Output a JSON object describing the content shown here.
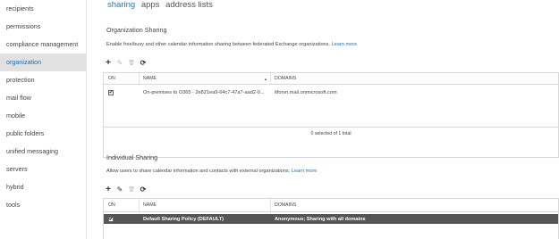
{
  "sidebar": {
    "items": [
      {
        "label": "recipients",
        "active": false
      },
      {
        "label": "permissions",
        "active": false
      },
      {
        "label": "compliance management",
        "active": false
      },
      {
        "label": "organization",
        "active": true
      },
      {
        "label": "protection",
        "active": false
      },
      {
        "label": "mail flow",
        "active": false
      },
      {
        "label": "mobile",
        "active": false
      },
      {
        "label": "public folders",
        "active": false
      },
      {
        "label": "unified messaging",
        "active": false
      },
      {
        "label": "servers",
        "active": false
      },
      {
        "label": "hybrid",
        "active": false
      },
      {
        "label": "tools",
        "active": false
      }
    ]
  },
  "tabs": [
    {
      "label": "sharing",
      "active": true
    },
    {
      "label": "apps",
      "active": false
    },
    {
      "label": "address lists",
      "active": false
    }
  ],
  "org_sharing": {
    "title": "Organization Sharing",
    "description": "Enable free/busy and other calendar information sharing between federated Exchange organizations.",
    "learn_more": "Learn more",
    "columns": {
      "on": "ON",
      "name": "NAME",
      "domains": "DOMAINS"
    },
    "rows": [
      {
        "on": true,
        "name": "On-premises to O365 - 2e821ea9-64c7-47a7-aad2-0...",
        "domains": "itforvn.mail.onmicrosoft.com"
      }
    ],
    "status": "0 selected of 1 total"
  },
  "individual_sharing": {
    "title": "Individual Sharing",
    "description": "Allow users to share calendar information and contacts with external organizations.",
    "learn_more": "Learn more",
    "columns": {
      "on": "ON",
      "name": "NAME",
      "domains": "DOMAINS"
    },
    "rows": [
      {
        "on": true,
        "name": "Default Sharing Policy (DEFAULT)",
        "domains": "Anonymous; Sharing with all domains"
      }
    ]
  },
  "toolbar": {
    "add_symbol": "+",
    "edit_symbol": "✎",
    "delete_symbol": "🗑",
    "refresh_symbol": "⟳",
    "check_symbol": "✔"
  },
  "colors": {
    "accent": "#1f7bc4",
    "selected_row": "#555555",
    "sidebar_active": "#e1e1e1"
  }
}
